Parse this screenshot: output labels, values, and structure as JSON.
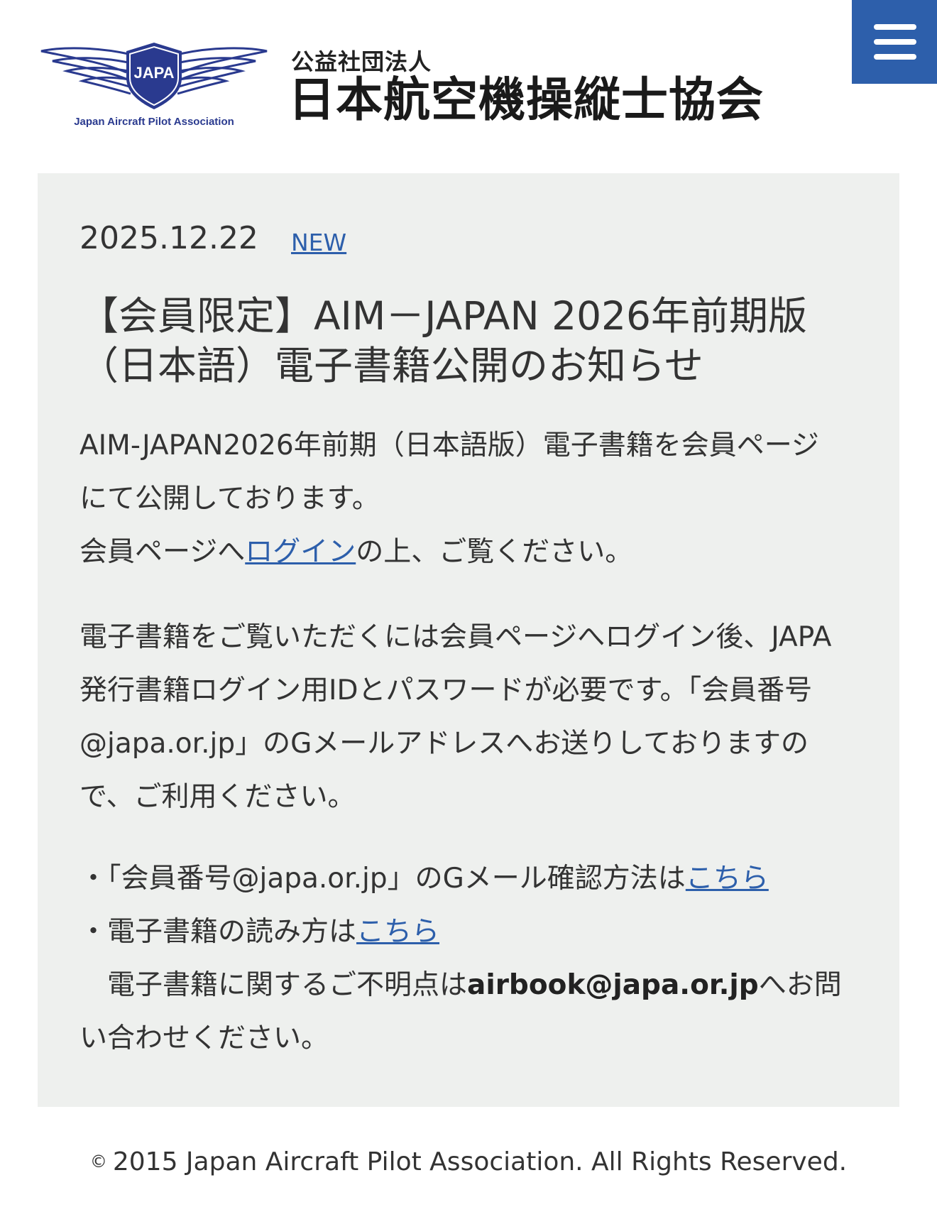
{
  "header": {
    "logo_text": "JAPA",
    "logo_caption": "Japan Aircraft Pilot Association",
    "org_subtitle": "公益社団法人",
    "org_name": "日本航空機操縦士協会",
    "menu_icon": "hamburger-menu-icon",
    "menu_color": "#2d5fab"
  },
  "article": {
    "date": "2025.12.22",
    "badge": "NEW",
    "title": "【会員限定】AIM－JAPAN 2026年前期版（日本語）電子書籍公開のお知らせ",
    "p1_line1": "AIM-JAPAN2026年前期（日本語版）電子書籍を会員ページにて公開しております。",
    "p1_line2_pre": "会員ページへ",
    "p1_line2_link": "ログイン",
    "p1_line2_post": "の上、ご覧ください。",
    "p2": "電子書籍をご覧いただくには会員ページへログイン後、JAPA発行書籍ログイン用IDとパスワードが必要です。「会員番号@japa.or.jp」のGメールアドレスへお送りしておりますので、ご利用ください。",
    "item1_pre": "・「会員番号@japa.or.jp」のGメール確認方法は",
    "item1_link": "こちら",
    "item2_pre": "・電子書籍の読み方は",
    "item2_link": "こちら",
    "contact_pre": "　電子書籍に関するご不明点は",
    "contact_email": "airbook@japa.or.jp",
    "contact_post": "へお問い合わせください。"
  },
  "footer": {
    "copyright_symbol": "©",
    "text": "2015 Japan Aircraft Pilot Association. All Rights Reserved."
  }
}
